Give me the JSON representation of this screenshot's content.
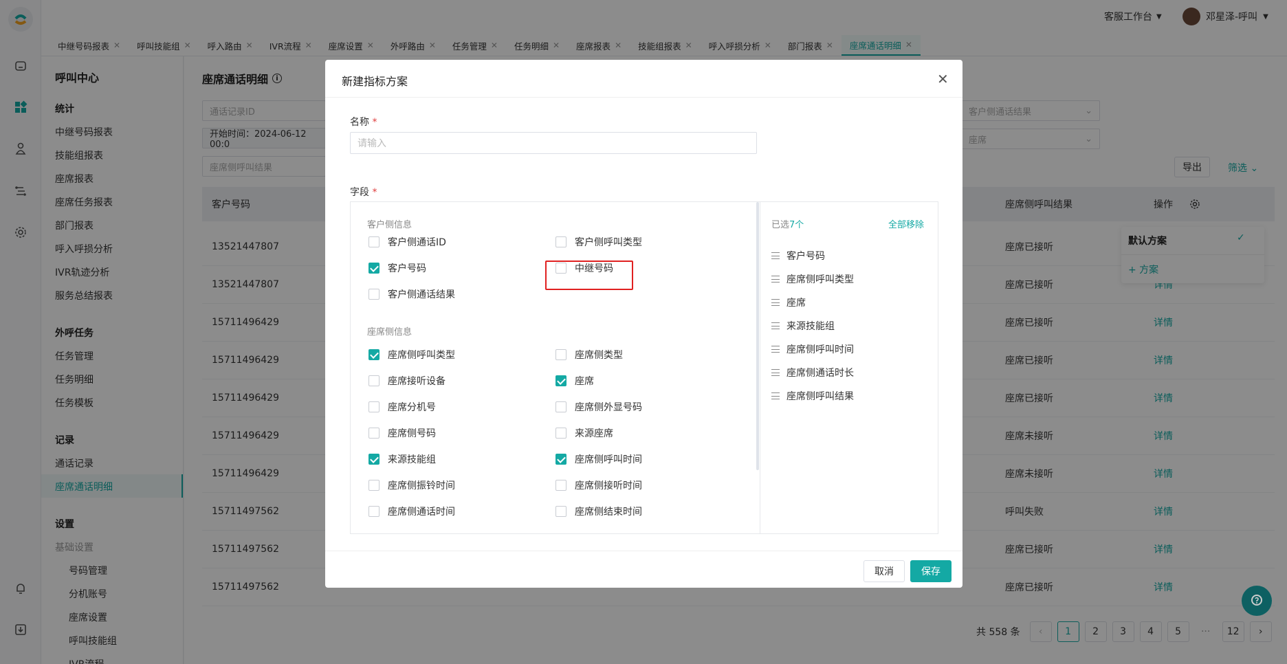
{
  "topbar": {
    "workspace": "客服工作台",
    "user_name": "邓星泽-呼叫"
  },
  "tabs": [
    "中继号码报表",
    "呼叫技能组",
    "呼入路由",
    "IVR流程",
    "座席设置",
    "外呼路由",
    "任务管理",
    "任务明细",
    "座席报表",
    "技能组报表",
    "呼入呼损分析",
    "部门报表",
    "座席通话明细"
  ],
  "sidebar": {
    "title": "呼叫中心",
    "stats_heading": "统计",
    "stats_items": [
      "中继号码报表",
      "技能组报表",
      "座席报表",
      "座席任务报表",
      "部门报表",
      "呼入呼损分析",
      "IVR轨迹分析",
      "服务总结报表"
    ],
    "outbound_heading": "外呼任务",
    "outbound_items": [
      "任务管理",
      "任务明细",
      "任务模板"
    ],
    "records_heading": "记录",
    "records_items": [
      "通话记录",
      "座席通话明细"
    ],
    "settings_heading": "设置",
    "basic_settings": "基础设置",
    "settings_items": [
      "号码管理",
      "分机账号",
      "座席设置",
      "呼叫技能组",
      "IVR流程"
    ]
  },
  "main": {
    "title": "座席通话明细",
    "filter_call_id_placeholder": "通话记录ID",
    "filter_start_time": "开始时间：2024-06-12 00:0",
    "filter_agent_result_placeholder": "座席侧呼叫结果",
    "filter_customer_result_placeholder": "客户侧通话结果",
    "filter_agent_placeholder": "座席",
    "export_label": "导出",
    "filter_label": "筛选",
    "col_customer_number": "客户号码",
    "col_agent_result": "座席侧呼叫结果",
    "col_actions": "操作",
    "rows": [
      {
        "number": "13521447807",
        "result": "座席已接听",
        "action": ""
      },
      {
        "number": "13521447807",
        "result": "座席已接听",
        "action": "详情"
      },
      {
        "number": "15711496429",
        "result": "座席已接听",
        "action": "详情"
      },
      {
        "number": "15711496429",
        "result": "座席已接听",
        "action": "详情"
      },
      {
        "number": "15711496429",
        "result": "座席已接听",
        "action": "详情"
      },
      {
        "number": "15711496429",
        "result": "座席未接听",
        "action": "详情"
      },
      {
        "number": "15711496429",
        "result": "座席未接听",
        "action": "详情"
      },
      {
        "number": "15711497562",
        "result": "呼叫失败",
        "action": "详情"
      },
      {
        "number": "15711497562",
        "result": "座席已接听",
        "action": "详情"
      },
      {
        "number": "15711497562",
        "result": "座席已接听",
        "action": "详情"
      }
    ],
    "pager": {
      "total": "共 558 条",
      "pages": [
        "1",
        "2",
        "3",
        "4",
        "5"
      ],
      "ellipsis": "···",
      "last": "12"
    }
  },
  "popup": {
    "default_scheme": "默认方案",
    "add_scheme": "+ 方案"
  },
  "modal": {
    "title": "新建指标方案",
    "name_label": "名称",
    "name_placeholder": "请输入",
    "fields_label": "字段",
    "customer_group": "客户侧信息",
    "customer_fields": [
      {
        "label": "客户侧通话ID",
        "checked": false
      },
      {
        "label": "客户侧呼叫类型",
        "checked": false
      },
      {
        "label": "客户号码",
        "checked": true
      },
      {
        "label": "中继号码",
        "checked": false
      },
      {
        "label": "客户侧通话结果",
        "checked": false
      }
    ],
    "agent_group": "座席侧信息",
    "agent_fields": [
      {
        "label": "座席侧呼叫类型",
        "checked": true
      },
      {
        "label": "座席侧类型",
        "checked": false
      },
      {
        "label": "座席接听设备",
        "checked": false
      },
      {
        "label": "座席",
        "checked": true
      },
      {
        "label": "座席分机号",
        "checked": false
      },
      {
        "label": "座席侧外显号码",
        "checked": false
      },
      {
        "label": "座席侧号码",
        "checked": false
      },
      {
        "label": "来源座席",
        "checked": false
      },
      {
        "label": "来源技能组",
        "checked": true
      },
      {
        "label": "座席侧呼叫时间",
        "checked": true
      },
      {
        "label": "座席侧振铃时间",
        "checked": false
      },
      {
        "label": "座席侧接听时间",
        "checked": false
      },
      {
        "label": "座席侧通话时间",
        "checked": false
      },
      {
        "label": "座席侧结束时间",
        "checked": false
      }
    ],
    "selected_prefix": "已选",
    "selected_count": "7个",
    "remove_all": "全部移除",
    "selected": [
      "客户号码",
      "座席侧呼叫类型",
      "座席",
      "来源技能组",
      "座席侧呼叫时间",
      "座席侧通话时长",
      "座席侧呼叫结果"
    ],
    "cancel_label": "取消",
    "save_label": "保存"
  },
  "colors": {
    "accent": "#14a9a4",
    "highlight": "#e02020"
  }
}
